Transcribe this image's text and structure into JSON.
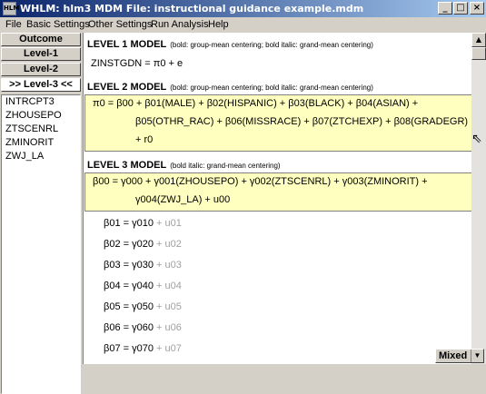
{
  "window": {
    "icon_text": "HLM",
    "title": "WHLM: hlm3 MDM File: instructional guidance example.mdm",
    "min_label": "_",
    "max_label": "□",
    "close_label": "×"
  },
  "menu": [
    "File",
    "Basic Settings",
    "Other Settings",
    "Run Analysis",
    "Help"
  ],
  "nav": {
    "outcome": "Outcome",
    "level1": "Level-1",
    "level2": "Level-2",
    "level3": ">> Level-3 <<"
  },
  "variables": [
    "INTRCPT3",
    "ZHOUSEPO",
    "ZTSCENRL",
    "ZMINORIT",
    "ZWJ_LA"
  ],
  "model": {
    "l1_header": "LEVEL 1 MODEL",
    "l1_note": "(bold: group-mean centering; bold italic: grand-mean centering)",
    "l1_eq": "ZINSTGDN = π0 + e",
    "l2_header": "LEVEL 2 MODEL",
    "l2_note": "(bold: group-mean centering; bold italic: grand-mean centering)",
    "l2_eq_line1": "π0 = β00 + β01(MALE) + β02(HISPANIC) + β03(BLACK) + β04(ASIAN) +",
    "l2_eq_line2": "β05(OTHR_RAC) + β06(MISSRACE) + β07(ZTCHEXP) + β08(GRADEGR)",
    "l2_eq_line3": "+ r0",
    "l3_header": "LEVEL 3 MODEL",
    "l3_note": "(bold italic: grand-mean centering)",
    "l3_eq_line1": "β00 = γ000 + γ001(ZHOUSEPO) + γ002(ZTSCENRL) + γ003(ZMINORIT) +",
    "l3_eq_line2": "γ004(ZWJ_LA) + u00",
    "betas": [
      {
        "lhs": "β01",
        "rhs": "γ010",
        "tail": "+ u01"
      },
      {
        "lhs": "β02",
        "rhs": "γ020",
        "tail": "+ u02"
      },
      {
        "lhs": "β03",
        "rhs": "γ030",
        "tail": "+ u03"
      },
      {
        "lhs": "β04",
        "rhs": "γ040",
        "tail": "+ u04"
      },
      {
        "lhs": "β05",
        "rhs": "γ050",
        "tail": "+ u05"
      },
      {
        "lhs": "β06",
        "rhs": "γ060",
        "tail": "+ u06"
      },
      {
        "lhs": "β07",
        "rhs": "γ070",
        "tail": "+ u07"
      }
    ]
  },
  "status": {
    "mixed_label": "Mixed"
  },
  "colors": {
    "highlight": "#ffffc0",
    "title_bar": "#0a246a",
    "inactive_term": "#a0a0a0"
  }
}
